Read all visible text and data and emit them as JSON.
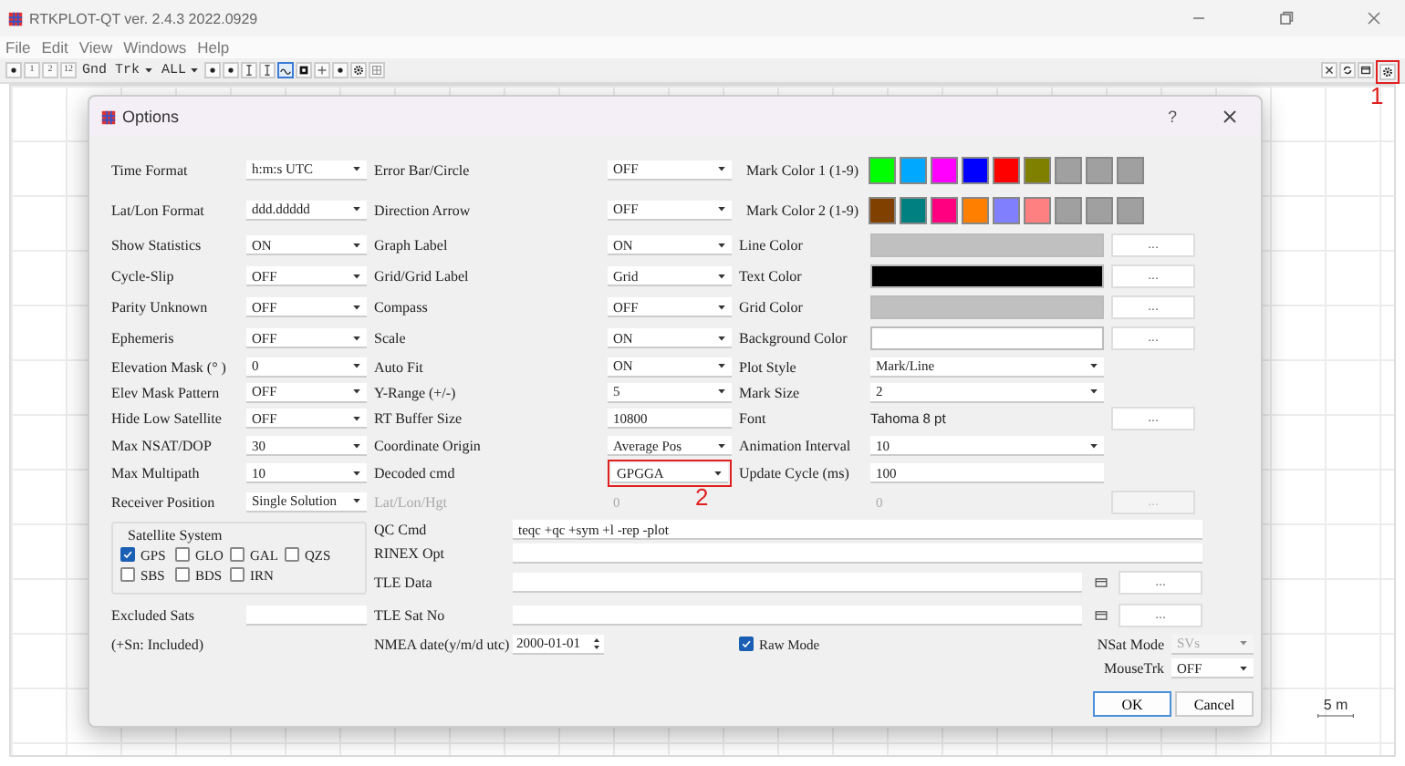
{
  "window": {
    "title": "RTKPLOT-QT ver. 2.4.3 2022.0929"
  },
  "menu": [
    "File",
    "Edit",
    "View",
    "Windows",
    "Help"
  ],
  "toolbar": [
    {
      "kind": "dot",
      "selected": false
    },
    {
      "kind": "text",
      "label": "1",
      "selected": false
    },
    {
      "kind": "text",
      "label": "2",
      "selected": false
    },
    {
      "kind": "text",
      "label": "12",
      "selected": false
    },
    {
      "kind": "combo",
      "value": "Gnd Trk",
      "selected": false
    },
    {
      "kind": "combo",
      "value": "ALL",
      "selected": false
    },
    {
      "kind": "dot",
      "selected": false
    },
    {
      "kind": "dot",
      "selected": false
    },
    {
      "kind": "bar",
      "selected": false
    },
    {
      "kind": "bar",
      "selected": false
    },
    {
      "kind": "wave",
      "selected": true
    },
    {
      "kind": "square",
      "selected": false
    },
    {
      "kind": "plus",
      "selected": false
    },
    {
      "kind": "dot",
      "selected": false
    },
    {
      "kind": "gear",
      "selected": false
    },
    {
      "kind": "grid",
      "selected": false
    }
  ],
  "toolbar_right": [
    {
      "kind": "close",
      "highlighted": false
    },
    {
      "kind": "refresh",
      "highlighted": false
    },
    {
      "kind": "window",
      "highlighted": false
    },
    {
      "kind": "gear",
      "highlighted": true,
      "annotation": "1"
    }
  ],
  "plot": {
    "scale_label": "5 m"
  },
  "dialog": {
    "title": "Options",
    "help": "?",
    "rows": [
      {
        "left": {
          "label": "Time Format",
          "value": "h:m:s UTC",
          "kind": "combo"
        },
        "middle": {
          "label": "Error Bar/Circle",
          "value": "OFF",
          "kind": "combo"
        },
        "right": {
          "label": "Mark Color 1 (1-9)",
          "kind": "swatches",
          "colors": [
            {
              "color": "#00ff00"
            },
            {
              "color": "#00a8ff"
            },
            {
              "color": "#ff00ff"
            },
            {
              "color": "#0000ff"
            },
            {
              "color": "#ff0000"
            },
            {
              "color": "#808000"
            },
            {
              "color": "#a0a0a0"
            },
            {
              "color": "#a0a0a0"
            },
            {
              "color": "#a0a0a0"
            }
          ]
        }
      },
      {
        "left": {
          "label": "Lat/Lon Format",
          "value": "ddd.ddddd",
          "kind": "combo"
        },
        "middle": {
          "label": "Direction Arrow",
          "value": "OFF",
          "kind": "combo"
        },
        "right": {
          "label": "Mark Color 2 (1-9)",
          "kind": "swatches",
          "colors": [
            {
              "color": "#804000"
            },
            {
              "color": "#008080"
            },
            {
              "color": "#ff0080"
            },
            {
              "color": "#ff8000"
            },
            {
              "color": "#8080ff"
            },
            {
              "color": "#ff8080"
            },
            {
              "color": "#a0a0a0"
            },
            {
              "color": "#a0a0a0"
            },
            {
              "color": "#a0a0a0"
            }
          ]
        }
      },
      {
        "left": {
          "label": "Show Statistics",
          "value": "ON",
          "kind": "combo"
        },
        "middle": {
          "label": "Graph Label",
          "value": "ON",
          "kind": "combo"
        },
        "right": {
          "label": "Line Color",
          "kind": "color",
          "color": "#c0c0c0",
          "button": {
            "label": "...",
            "disabled": false
          }
        }
      },
      {
        "left": {
          "label": "Cycle-Slip",
          "value": "OFF",
          "kind": "combo"
        },
        "middle": {
          "label": "Grid/Grid Label",
          "value": "Grid",
          "kind": "combo"
        },
        "right": {
          "label": "Text Color",
          "kind": "color",
          "color": "#000000",
          "button": {
            "label": "...",
            "disabled": false
          }
        }
      },
      {
        "left": {
          "label": "Parity Unknown",
          "value": "OFF",
          "kind": "combo"
        },
        "middle": {
          "label": "Compass",
          "value": "OFF",
          "kind": "combo"
        },
        "right": {
          "label": "Grid Color",
          "kind": "color",
          "color": "#c0c0c0",
          "button": {
            "label": "...",
            "disabled": false
          }
        }
      },
      {
        "left": {
          "label": "Ephemeris",
          "value": "OFF",
          "kind": "combo"
        },
        "middle": {
          "label": "Scale",
          "value": "ON",
          "kind": "combo"
        },
        "right": {
          "label": "Background Color",
          "kind": "color",
          "color": "#ffffff",
          "button": {
            "label": "...",
            "disabled": false
          }
        }
      },
      {
        "left": {
          "label": "Elevation Mask (° )",
          "value": "0",
          "kind": "combo"
        },
        "middle": {
          "label": "Auto Fit",
          "value": "ON",
          "kind": "combo"
        },
        "right": {
          "label": "Plot Style",
          "value": "Mark/Line",
          "kind": "combo"
        }
      },
      {
        "left": {
          "label": "Elev Mask Pattern",
          "value": "OFF",
          "kind": "combo"
        },
        "middle": {
          "label": "Y-Range (+/-)",
          "value": "5",
          "kind": "combo"
        },
        "right": {
          "label": "Mark Size",
          "value": "2",
          "kind": "combo"
        }
      },
      {
        "left": {
          "label": "Hide Low Satellite",
          "value": "OFF",
          "kind": "combo"
        },
        "middle": {
          "label": "RT Buffer Size",
          "value": "10800",
          "kind": "field"
        },
        "right": {
          "label": "Font",
          "value": "Tahoma 8 pt",
          "kind": "text",
          "button": {
            "label": "...",
            "disabled": false
          }
        }
      },
      {
        "left": {
          "label": "Max NSAT/DOP",
          "value": "30",
          "kind": "combo"
        },
        "middle": {
          "label": "Coordinate Origin",
          "value": "Average Pos",
          "kind": "combo"
        },
        "right": {
          "label": "Animation Interval",
          "value": "10",
          "kind": "combo"
        }
      },
      {
        "left": {
          "label": "Max Multipath",
          "value": "10",
          "kind": "combo"
        },
        "middle": {
          "label": "Decoded cmd",
          "value": "GPGGA",
          "kind": "combo",
          "highlighted": true,
          "annotation": "2"
        },
        "right": {
          "label": "Update Cycle (ms)",
          "value": "100",
          "kind": "field"
        }
      },
      {
        "left": {
          "label": "Receiver Position",
          "value": "Single Solution",
          "kind": "combo"
        },
        "middle": {
          "label": "Lat/Lon/Hgt",
          "value": "0",
          "kind": "field",
          "disabled": true
        },
        "right": {
          "value": "0",
          "kind": "field",
          "disabled": true,
          "button": {
            "label": "...",
            "disabled": true
          }
        }
      }
    ],
    "satellite_system": {
      "title": "Satellite System",
      "systems": [
        {
          "label": "GPS",
          "checked": true
        },
        {
          "label": "GLO",
          "checked": false
        },
        {
          "label": "GAL",
          "checked": false
        },
        {
          "label": "QZS",
          "checked": false
        },
        {
          "label": "SBS",
          "checked": false
        },
        {
          "label": "BDS",
          "checked": false
        },
        {
          "label": "IRN",
          "checked": false
        }
      ]
    },
    "excluded_sats": {
      "label": "Excluded Sats"
    },
    "note": "(+Sn: Included)",
    "commands": [
      {
        "label": "QC Cmd",
        "value": "teqc +qc +sym +l -rep -plot",
        "kind": "wide"
      },
      {
        "label": "RINEX Opt",
        "kind": "wide"
      },
      {
        "label": "TLE Data",
        "kind": "file",
        "button": "..."
      },
      {
        "label": "TLE Sat No",
        "kind": "file",
        "button": "..."
      }
    ],
    "nmea_date": {
      "label": "NMEA date(y/m/d utc)",
      "value": "2000-01-01"
    },
    "raw_mode": {
      "label": "Raw Mode",
      "checked": true
    },
    "nsat_mode": {
      "label": "NSat Mode",
      "value": "SVs",
      "disabled": true
    },
    "mouse_trk": {
      "label": "MouseTrk",
      "value": "OFF",
      "disabled": false
    },
    "buttons": [
      {
        "label": "OK",
        "default": true
      },
      {
        "label": "Cancel",
        "default": false
      }
    ]
  }
}
